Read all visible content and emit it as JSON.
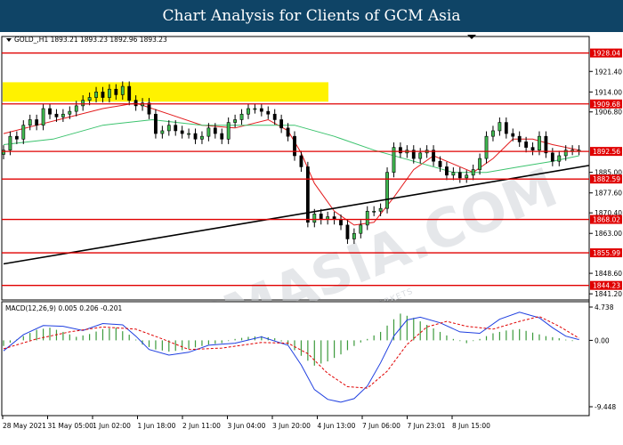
{
  "header": {
    "title": "Chart Analysis for Clients of GCM Asia"
  },
  "chart_data": {
    "type": "candlestick",
    "symbol_label": "GOLD_,H1",
    "ohlc_readout": "1893.21 1893.23 1892.96 1893.23",
    "watermark": "GCMASIA.COM",
    "watermark_sub": "GLOBAL CAPITAL MARKETS",
    "ylim": [
      1839,
      1934
    ],
    "price_ticks": [
      {
        "value": 1921.4,
        "label": "1921.40"
      },
      {
        "value": 1914.0,
        "label": "1914.00"
      },
      {
        "value": 1906.8,
        "label": "1906.80"
      },
      {
        "value": 1885.0,
        "label": "1885.00"
      },
      {
        "value": 1877.6,
        "label": "1877.60"
      },
      {
        "value": 1870.4,
        "label": "1870.40"
      },
      {
        "value": 1863.0,
        "label": "1863.00"
      },
      {
        "value": 1848.6,
        "label": "1848.60"
      },
      {
        "value": 1841.2,
        "label": "1841.20"
      }
    ],
    "horizontal_levels": [
      {
        "value": 1928.04,
        "label": "1928.04"
      },
      {
        "value": 1909.68,
        "label": "1909.68"
      },
      {
        "value": 1892.56,
        "label": "1892.56"
      },
      {
        "value": 1882.59,
        "label": "1882.59"
      },
      {
        "value": 1868.02,
        "label": "1868.02"
      },
      {
        "value": 1855.99,
        "label": "1855.99"
      },
      {
        "value": 1844.23,
        "label": "1844.23"
      }
    ],
    "x_labels": [
      "28 May 2021",
      "31 May 05:00",
      "1 Jun 02:00",
      "1 Jun 18:00",
      "2 Jun 11:00",
      "3 Jun 04:00",
      "3 Jun 20:00",
      "4 Jun 13:00",
      "7 Jun 06:00",
      "7 Jun 23:01",
      "8 Jun 15:00"
    ],
    "resistance_zone": {
      "from": 1910.5,
      "to": 1917.5
    },
    "trendline": {
      "start": {
        "bar": 0,
        "price": 1852.0
      },
      "end": {
        "bar": 175,
        "price": 1887.5
      }
    },
    "close_path": [
      [
        0,
        1893
      ],
      [
        2,
        1898
      ],
      [
        4,
        1897
      ],
      [
        6,
        1902
      ],
      [
        8,
        1904
      ],
      [
        10,
        1902
      ],
      [
        12,
        1908
      ],
      [
        14,
        1906
      ],
      [
        16,
        1905
      ],
      [
        18,
        1906
      ],
      [
        20,
        1907
      ],
      [
        22,
        1909
      ],
      [
        24,
        1911
      ],
      [
        26,
        1912
      ],
      [
        28,
        1914
      ],
      [
        30,
        1912
      ],
      [
        32,
        1915
      ],
      [
        34,
        1913
      ],
      [
        36,
        1916
      ],
      [
        38,
        1911
      ],
      [
        40,
        1909
      ],
      [
        42,
        1910
      ],
      [
        44,
        1906
      ],
      [
        46,
        1899
      ],
      [
        48,
        1900
      ],
      [
        50,
        1902
      ],
      [
        52,
        1900
      ],
      [
        54,
        1899
      ],
      [
        56,
        1899
      ],
      [
        58,
        1897
      ],
      [
        60,
        1898
      ],
      [
        62,
        1901
      ],
      [
        64,
        1899
      ],
      [
        66,
        1897
      ],
      [
        68,
        1903
      ],
      [
        70,
        1904
      ],
      [
        72,
        1906
      ],
      [
        74,
        1908
      ],
      [
        76,
        1908
      ],
      [
        78,
        1907
      ],
      [
        80,
        1906
      ],
      [
        82,
        1904
      ],
      [
        84,
        1901
      ],
      [
        86,
        1898
      ],
      [
        88,
        1891
      ],
      [
        90,
        1887
      ],
      [
        92,
        1867
      ],
      [
        94,
        1870
      ],
      [
        96,
        1868
      ],
      [
        98,
        1869
      ],
      [
        100,
        1868
      ],
      [
        102,
        1866
      ],
      [
        104,
        1861
      ],
      [
        106,
        1863
      ],
      [
        108,
        1866
      ],
      [
        110,
        1871
      ],
      [
        112,
        1871
      ],
      [
        114,
        1872
      ],
      [
        116,
        1885
      ],
      [
        118,
        1894
      ],
      [
        120,
        1892
      ],
      [
        122,
        1893
      ],
      [
        124,
        1890
      ],
      [
        126,
        1892
      ],
      [
        128,
        1893
      ],
      [
        130,
        1889
      ],
      [
        132,
        1887
      ],
      [
        134,
        1884
      ],
      [
        136,
        1885
      ],
      [
        138,
        1883
      ],
      [
        140,
        1884
      ],
      [
        142,
        1886
      ],
      [
        144,
        1890
      ],
      [
        146,
        1898
      ],
      [
        148,
        1900
      ],
      [
        150,
        1903
      ],
      [
        152,
        1899
      ],
      [
        154,
        1898
      ],
      [
        156,
        1896
      ],
      [
        158,
        1894
      ],
      [
        160,
        1893
      ],
      [
        162,
        1898
      ],
      [
        164,
        1892
      ],
      [
        166,
        1889
      ],
      [
        168,
        1891
      ],
      [
        170,
        1893
      ],
      [
        172,
        1893
      ],
      [
        174,
        1893
      ]
    ],
    "moving_averages": [
      {
        "color": "#e31a1c",
        "values": [
          [
            0,
            1899
          ],
          [
            10,
            1902
          ],
          [
            20,
            1905
          ],
          [
            30,
            1908
          ],
          [
            40,
            1910
          ],
          [
            50,
            1906
          ],
          [
            60,
            1902
          ],
          [
            70,
            1901
          ],
          [
            80,
            1904
          ],
          [
            86,
            1900
          ],
          [
            90,
            1892
          ],
          [
            94,
            1881
          ],
          [
            100,
            1871
          ],
          [
            106,
            1866
          ],
          [
            112,
            1867
          ],
          [
            118,
            1876
          ],
          [
            124,
            1886
          ],
          [
            130,
            1891
          ],
          [
            136,
            1888
          ],
          [
            142,
            1885
          ],
          [
            148,
            1890
          ],
          [
            154,
            1897
          ],
          [
            160,
            1897
          ],
          [
            166,
            1895
          ],
          [
            174,
            1893
          ]
        ]
      },
      {
        "color": "#3cc36e",
        "values": [
          [
            0,
            1895
          ],
          [
            15,
            1897
          ],
          [
            30,
            1902
          ],
          [
            45,
            1904
          ],
          [
            60,
            1902
          ],
          [
            75,
            1902
          ],
          [
            88,
            1902
          ],
          [
            100,
            1898
          ],
          [
            112,
            1893
          ],
          [
            124,
            1889
          ],
          [
            136,
            1885
          ],
          [
            146,
            1885
          ],
          [
            156,
            1887
          ],
          [
            166,
            1889
          ],
          [
            174,
            1891
          ]
        ]
      }
    ],
    "macd": {
      "label": "MACD(12,26,9) 0.005 0.206 -0.201",
      "ylim": [
        -9.448,
        4.738
      ],
      "ticks": [
        {
          "value": 4.738,
          "label": "4.738"
        },
        {
          "value": 0.0,
          "label": "0.00"
        },
        {
          "value": -9.448,
          "label": "-9.448"
        }
      ],
      "histogram": [
        [
          0,
          -0.8
        ],
        [
          6,
          0.6
        ],
        [
          10,
          1.5
        ],
        [
          14,
          1.8
        ],
        [
          18,
          1.2
        ],
        [
          22,
          0.5
        ],
        [
          26,
          0.9
        ],
        [
          30,
          1.6
        ],
        [
          34,
          1.8
        ],
        [
          38,
          0.8
        ],
        [
          42,
          -0.6
        ],
        [
          46,
          -1.3
        ],
        [
          50,
          -1.6
        ],
        [
          54,
          -1.4
        ],
        [
          58,
          -1.0
        ],
        [
          62,
          -0.6
        ],
        [
          66,
          -0.4
        ],
        [
          70,
          0.2
        ],
        [
          74,
          0.5
        ],
        [
          78,
          0.6
        ],
        [
          82,
          0.3
        ],
        [
          86,
          -0.6
        ],
        [
          90,
          -2.2
        ],
        [
          94,
          -3.6
        ],
        [
          98,
          -3.0
        ],
        [
          102,
          -2.0
        ],
        [
          106,
          -0.8
        ],
        [
          110,
          0.2
        ],
        [
          114,
          1.2
        ],
        [
          118,
          3.0
        ],
        [
          120,
          3.8
        ],
        [
          124,
          3.2
        ],
        [
          128,
          2.2
        ],
        [
          132,
          1.2
        ],
        [
          136,
          0.2
        ],
        [
          140,
          -0.4
        ],
        [
          144,
          0.2
        ],
        [
          148,
          1.0
        ],
        [
          152,
          1.4
        ],
        [
          156,
          1.6
        ],
        [
          160,
          1.1
        ],
        [
          164,
          0.6
        ],
        [
          168,
          0.3
        ],
        [
          172,
          -0.1
        ],
        [
          174,
          0.0
        ]
      ],
      "macd_line": [
        [
          0,
          -1.5
        ],
        [
          6,
          0.8
        ],
        [
          12,
          2.1
        ],
        [
          18,
          2.0
        ],
        [
          24,
          1.4
        ],
        [
          30,
          2.4
        ],
        [
          36,
          2.2
        ],
        [
          40,
          0.6
        ],
        [
          44,
          -1.3
        ],
        [
          50,
          -2.1
        ],
        [
          56,
          -1.7
        ],
        [
          62,
          -0.7
        ],
        [
          70,
          -0.4
        ],
        [
          78,
          0.5
        ],
        [
          86,
          -0.7
        ],
        [
          90,
          -3.5
        ],
        [
          94,
          -7.0
        ],
        [
          98,
          -8.4
        ],
        [
          102,
          -8.8
        ],
        [
          106,
          -8.3
        ],
        [
          110,
          -6.5
        ],
        [
          114,
          -3.2
        ],
        [
          118,
          0.6
        ],
        [
          122,
          2.9
        ],
        [
          126,
          3.3
        ],
        [
          132,
          2.5
        ],
        [
          138,
          1.2
        ],
        [
          144,
          1.0
        ],
        [
          150,
          3.0
        ],
        [
          156,
          4.0
        ],
        [
          162,
          3.2
        ],
        [
          166,
          1.8
        ],
        [
          170,
          0.6
        ],
        [
          174,
          0.1
        ]
      ],
      "signal_line": [
        [
          0,
          -1.2
        ],
        [
          10,
          0.2
        ],
        [
          20,
          1.2
        ],
        [
          30,
          1.9
        ],
        [
          40,
          1.6
        ],
        [
          48,
          0.2
        ],
        [
          56,
          -1.3
        ],
        [
          66,
          -1.1
        ],
        [
          78,
          -0.3
        ],
        [
          86,
          -0.4
        ],
        [
          92,
          -1.9
        ],
        [
          98,
          -4.7
        ],
        [
          104,
          -6.6
        ],
        [
          110,
          -6.8
        ],
        [
          116,
          -4.4
        ],
        [
          122,
          -0.6
        ],
        [
          128,
          1.9
        ],
        [
          134,
          2.7
        ],
        [
          140,
          2.0
        ],
        [
          148,
          1.6
        ],
        [
          156,
          2.7
        ],
        [
          162,
          3.4
        ],
        [
          168,
          2.0
        ],
        [
          174,
          0.3
        ]
      ]
    }
  }
}
